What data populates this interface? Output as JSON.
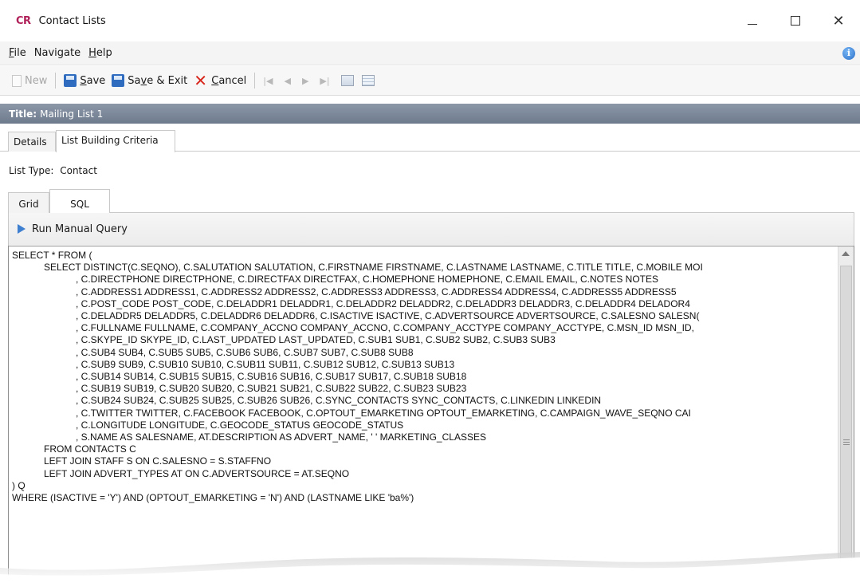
{
  "window": {
    "logo": "CR",
    "title": "Contact Lists",
    "minimize": "",
    "maximize": "",
    "close": "✕"
  },
  "menu": {
    "file": {
      "mnemonic": "F",
      "rest": "ile"
    },
    "navigate": {
      "label": "Navigate"
    },
    "help": {
      "mnemonic": "H",
      "rest": "elp"
    },
    "info_glyph": "i"
  },
  "toolbar": {
    "new_label": "New",
    "save": {
      "mnemonic": "S",
      "rest": "ave"
    },
    "save_exit": {
      "pre": "Sa",
      "mnemonic": "v",
      "rest": "e & Exit"
    },
    "cancel": {
      "mnemonic": "C",
      "rest": "ancel"
    },
    "cancel_glyph": "✕",
    "nav_first": "|◀",
    "nav_prev": "◀",
    "nav_next": "▶",
    "nav_last": "▶|"
  },
  "record": {
    "title_label": "Title:",
    "title_value": "Mailing List 1"
  },
  "tabs": {
    "details": "Details",
    "list_building_criteria": "List Building Criteria"
  },
  "list_type": {
    "label": "List Type:",
    "value": "Contact"
  },
  "subtabs": {
    "grid": "Grid",
    "sql": "SQL"
  },
  "run_query": {
    "label": "Run Manual Query"
  },
  "sql": {
    "lines": [
      "SELECT * FROM (",
      "            SELECT DISTINCT(C.SEQNO), C.SALUTATION SALUTATION, C.FIRSTNAME FIRSTNAME, C.LASTNAME LASTNAME, C.TITLE TITLE, C.MOBILE MOI",
      "                        , C.DIRECTPHONE DIRECTPHONE, C.DIRECTFAX DIRECTFAX, C.HOMEPHONE HOMEPHONE, C.EMAIL EMAIL, C.NOTES NOTES",
      "                        , C.ADDRESS1 ADDRESS1, C.ADDRESS2 ADDRESS2, C.ADDRESS3 ADDRESS3, C.ADDRESS4 ADDRESS4, C.ADDRESS5 ADDRESS5",
      "                        , C.POST_CODE POST_CODE, C.DELADDR1 DELADDR1, C.DELADDR2 DELADDR2, C.DELADDR3 DELADDR3, C.DELADDR4 DELADOR4",
      "                        , C.DELADDR5 DELADDR5, C.DELADDR6 DELADDR6, C.ISACTIVE ISACTIVE, C.ADVERTSOURCE ADVERTSOURCE, C.SALESNO SALESN(",
      "                        , C.FULLNAME FULLNAME, C.COMPANY_ACCNO COMPANY_ACCNO, C.COMPANY_ACCTYPE COMPANY_ACCTYPE, C.MSN_ID MSN_ID,",
      "                        , C.SKYPE_ID SKYPE_ID, C.LAST_UPDATED LAST_UPDATED, C.SUB1 SUB1, C.SUB2 SUB2, C.SUB3 SUB3",
      "                        , C.SUB4 SUB4, C.SUB5 SUB5, C.SUB6 SUB6, C.SUB7 SUB7, C.SUB8 SUB8",
      "                        , C.SUB9 SUB9, C.SUB10 SUB10, C.SUB11 SUB11, C.SUB12 SUB12, C.SUB13 SUB13",
      "                        , C.SUB14 SUB14, C.SUB15 SUB15, C.SUB16 SUB16, C.SUB17 SUB17, C.SUB18 SUB18",
      "                        , C.SUB19 SUB19, C.SUB20 SUB20, C.SUB21 SUB21, C.SUB22 SUB22, C.SUB23 SUB23",
      "                        , C.SUB24 SUB24, C.SUB25 SUB25, C.SUB26 SUB26, C.SYNC_CONTACTS SYNC_CONTACTS, C.LINKEDIN LINKEDIN",
      "                        , C.TWITTER TWITTER, C.FACEBOOK FACEBOOK, C.OPTOUT_EMARKETING OPTOUT_EMARKETING, C.CAMPAIGN_WAVE_SEQNO CAI",
      "                        , C.LONGITUDE LONGITUDE, C.GEOCODE_STATUS GEOCODE_STATUS",
      "                        , S.NAME AS SALESNAME, AT.DESCRIPTION AS ADVERT_NAME, ' ' MARKETING_CLASSES",
      "            FROM CONTACTS C",
      "            LEFT JOIN STAFF S ON C.SALESNO = S.STAFFNO",
      "            LEFT JOIN ADVERT_TYPES AT ON C.ADVERTSOURCE = AT.SEQNO",
      ") Q",
      "WHERE (ISACTIVE = 'Y') AND (OPTOUT_EMARKETING = 'N') AND (LASTNAME LIKE 'ba%')"
    ]
  }
}
